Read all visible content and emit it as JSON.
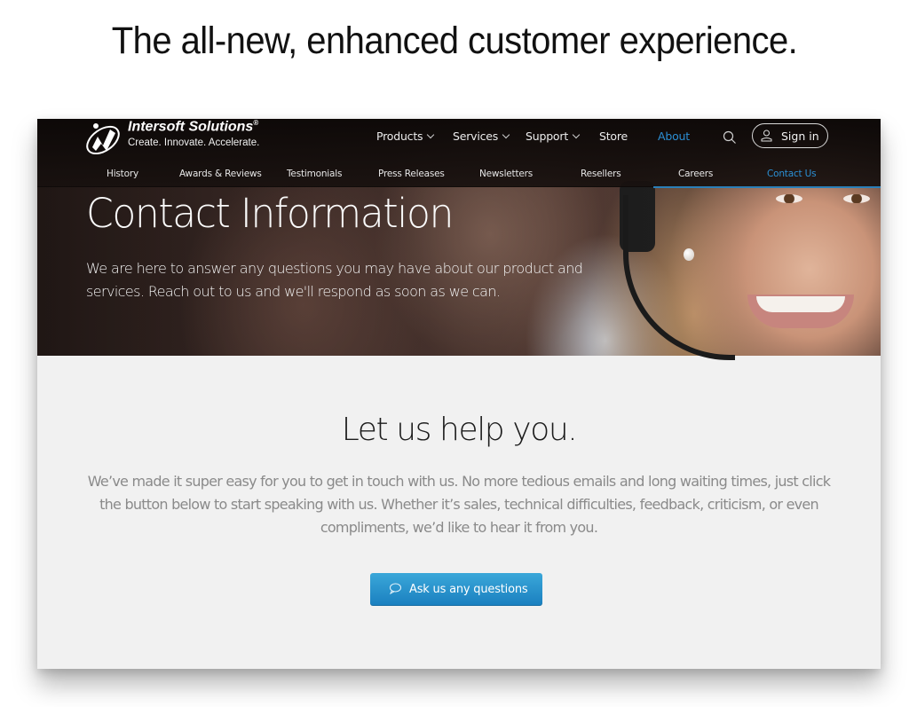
{
  "headline": "The all-new, enhanced customer experience.",
  "brand": {
    "name": "Intersoft Solutions",
    "registered_mark": "®",
    "tagline": "Create. Innovate. Accelerate."
  },
  "main_nav": {
    "items": [
      {
        "label": "Products",
        "has_dropdown": true
      },
      {
        "label": "Services",
        "has_dropdown": true
      },
      {
        "label": "Support",
        "has_dropdown": true
      },
      {
        "label": "Store",
        "has_dropdown": false
      },
      {
        "label": "About",
        "has_dropdown": false,
        "active": true
      }
    ],
    "search_icon": "search-icon",
    "sign_in_label": "Sign in",
    "sign_in_icon": "user-icon"
  },
  "sub_nav": {
    "items": [
      {
        "label": "History"
      },
      {
        "label": "Awards & Reviews"
      },
      {
        "label": "Testimonials"
      },
      {
        "label": "Press Releases"
      },
      {
        "label": "Newsletters"
      },
      {
        "label": "Resellers"
      },
      {
        "label": "Careers"
      },
      {
        "label": "Contact Us",
        "active": true
      }
    ]
  },
  "hero": {
    "title": "Contact Information",
    "subtitle": "We are here to answer any questions you may have about our product and services. Reach out to us and we'll respond as soon as we can."
  },
  "help": {
    "title": "Let us help you.",
    "body": "We’ve made it super easy for you to get in touch with us. No more tedious emails and long waiting times, just click the button below to start speaking with us. Whether it’s sales, technical difficulties, feedback, criticism, or even compliments, we’d like to hear it from you.",
    "button_label": "Ask us any questions",
    "button_icon": "speech-bubble-icon"
  },
  "colors": {
    "accent": "#2b8fd4",
    "button_top": "#3aa7d9",
    "button_bottom": "#1a7fbf",
    "content_bg": "#f1f1f1"
  }
}
